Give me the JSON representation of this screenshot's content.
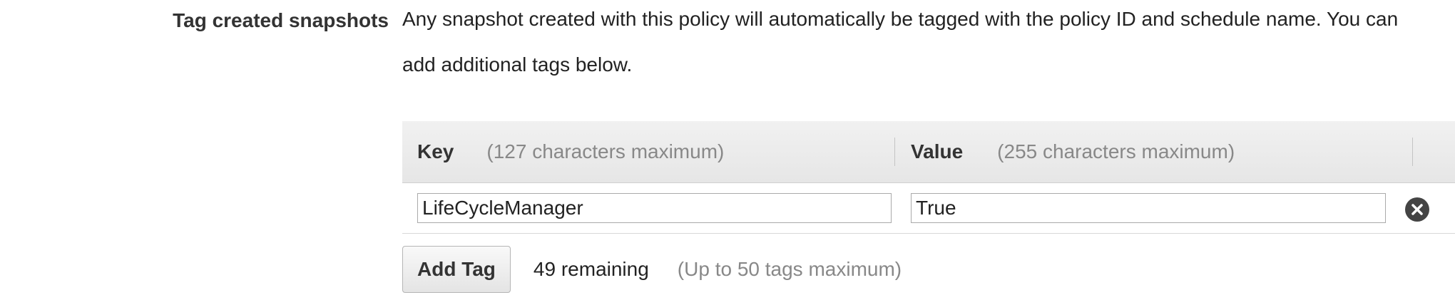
{
  "section": {
    "label": "Tag created snapshots",
    "description": "Any snapshot created with this policy will automatically be tagged with the policy ID and schedule name. You can add additional tags below."
  },
  "table": {
    "key_header": "Key",
    "key_hint": "(127 characters maximum)",
    "value_header": "Value",
    "value_hint": "(255 characters maximum)",
    "rows": [
      {
        "key": "LifeCycleManager",
        "value": "True",
        "remove_icon": "close-circle-icon"
      }
    ]
  },
  "footer": {
    "add_tag_label": "Add Tag",
    "remaining": "49 remaining",
    "limit_note": "(Up to 50 tags maximum)"
  }
}
